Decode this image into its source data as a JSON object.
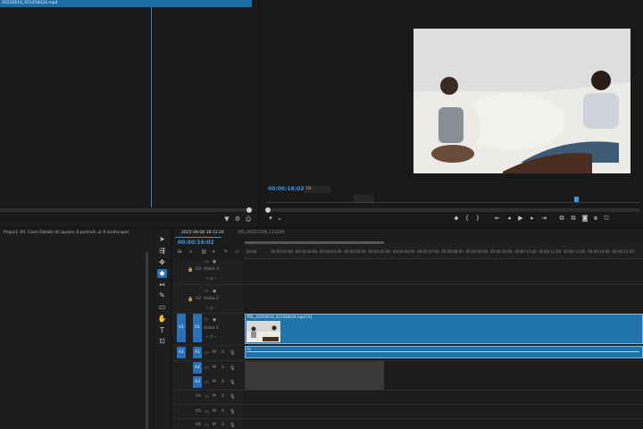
{
  "source": {
    "clip_name": "20250616_021458424.mp4"
  },
  "program": {
    "timecode": "00:00:16:02",
    "zoom": "Fit",
    "controls": [
      "marker",
      "in",
      "out",
      "go-to-in",
      "step-back",
      "play",
      "step-forward",
      "go-to-out",
      "insert",
      "overwrite",
      "export-frame",
      "compare",
      "settings"
    ]
  },
  "project": {
    "title": "Project: 04. Class Details (6 square, 6 portrait, or 6 landscape)"
  },
  "timeline": {
    "tab_active": "2025-06-08 18:12:24",
    "tab_other": "VID_20251109_112200",
    "timecode": "00:00:16:02",
    "ruler_ticks": [
      "00:00",
      "00:00:01:00",
      "00:00:02:00",
      "00:00:03:00",
      "00:00:04:00",
      "00:00:05:00",
      "00:00:06:00",
      "00:00:07:00",
      "00:00:08:00",
      "00:00:09:00",
      "00:00:10:00",
      "00:00:11:00",
      "00:00:12:00",
      "00:00:13:00",
      "00:00:14:00",
      "00:00:15:00"
    ],
    "tracks": {
      "v3": "V3",
      "v3_name": "Video 3",
      "v2": "V2",
      "v2_name": "Video 2",
      "v1": "V1",
      "v1_name": "Video 1",
      "a1": "A1",
      "a2": "A2",
      "a3": "A3",
      "a4": "A4",
      "a5": "A5",
      "a6": "A6",
      "m": "M",
      "s": "S"
    },
    "clip_v1_label": "PRL_20250616_021458424.mp4 [V]",
    "clip_a1_label": "fx"
  },
  "colors": {
    "accent": "#3b9ae6",
    "clip": "#1f74ab",
    "target": "#2b6fb8"
  }
}
